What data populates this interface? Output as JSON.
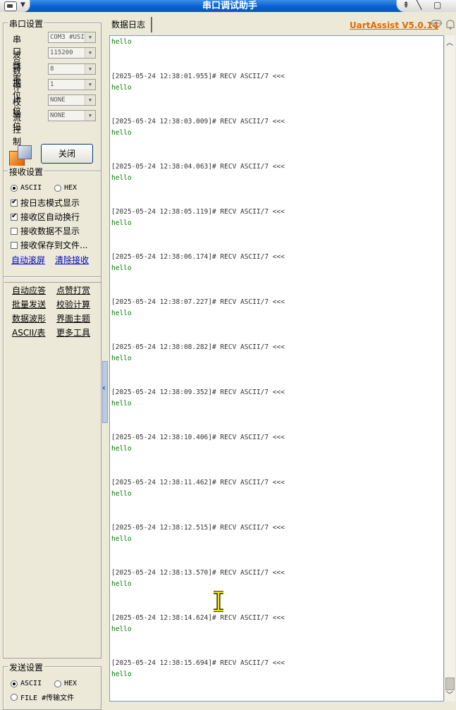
{
  "window": {
    "title": "串口调试助手"
  },
  "serial_settings": {
    "title": "串口设置",
    "fields": [
      {
        "label": "串口号",
        "value": "COM3 #USI"
      },
      {
        "label": "波特率",
        "value": "115200"
      },
      {
        "label": "数据位",
        "value": "8"
      },
      {
        "label": "停止位",
        "value": "1"
      },
      {
        "label": "校验位",
        "value": "NONE"
      },
      {
        "label": "流控制",
        "value": "NONE"
      }
    ],
    "close_label": "关闭"
  },
  "receive_settings": {
    "title": "接收设置",
    "mode_ascii": "ASCII",
    "mode_hex": "HEX",
    "options": [
      {
        "label": "按日志模式显示",
        "checked": true
      },
      {
        "label": "接收区自动换行",
        "checked": true
      },
      {
        "label": "接收数据不显示",
        "checked": false
      },
      {
        "label": "接收保存到文件...",
        "checked": false
      }
    ],
    "auto_scroll": "自动滚屏",
    "clear_receive": "清除接收"
  },
  "tools": {
    "items": [
      "自动应答",
      "点赞打赏",
      "批量发送",
      "校验计算",
      "数据波形",
      "界面主题",
      "ASCII/表",
      "更多工具"
    ]
  },
  "send_settings": {
    "title": "发送设置",
    "mode_ascii": "ASCII",
    "mode_hex": "HEX",
    "file_option": "FILE #传输文件"
  },
  "tab": {
    "label": "数据日志"
  },
  "brand": {
    "label": "UartAssist V5.0.14"
  },
  "log": {
    "first_line": "hello",
    "entries": [
      {
        "header": "[2025-05-24 12:38:01.955]# RECV ASCII/7 <<<",
        "data": "hello"
      },
      {
        "header": "[2025-05-24 12:38:03.009]# RECV ASCII/7 <<<",
        "data": "hello"
      },
      {
        "header": "[2025-05-24 12:38:04.063]# RECV ASCII/7 <<<",
        "data": "hello"
      },
      {
        "header": "[2025-05-24 12:38:05.119]# RECV ASCII/7 <<<",
        "data": "hello"
      },
      {
        "header": "[2025-05-24 12:38:06.174]# RECV ASCII/7 <<<",
        "data": "hello"
      },
      {
        "header": "[2025-05-24 12:38:07.227]# RECV ASCII/7 <<<",
        "data": "hello"
      },
      {
        "header": "[2025-05-24 12:38:08.282]# RECV ASCII/7 <<<",
        "data": "hello"
      },
      {
        "header": "[2025-05-24 12:38:09.352]# RECV ASCII/7 <<<",
        "data": "hello"
      },
      {
        "header": "[2025-05-24 12:38:10.406]# RECV ASCII/7 <<<",
        "data": "hello"
      },
      {
        "header": "[2025-05-24 12:38:11.462]# RECV ASCII/7 <<<",
        "data": "hello"
      },
      {
        "header": "[2025-05-24 12:38:12.515]# RECV ASCII/7 <<<",
        "data": "hello"
      },
      {
        "header": "[2025-05-24 12:38:13.570]# RECV ASCII/7 <<<",
        "data": "hello"
      },
      {
        "header": "[2025-05-24 12:38:14.624]# RECV ASCII/7 <<<",
        "data": "hello"
      },
      {
        "header": "[2025-05-24 12:38:15.694]# RECV ASCII/7 <<<",
        "data": "hello"
      }
    ]
  }
}
